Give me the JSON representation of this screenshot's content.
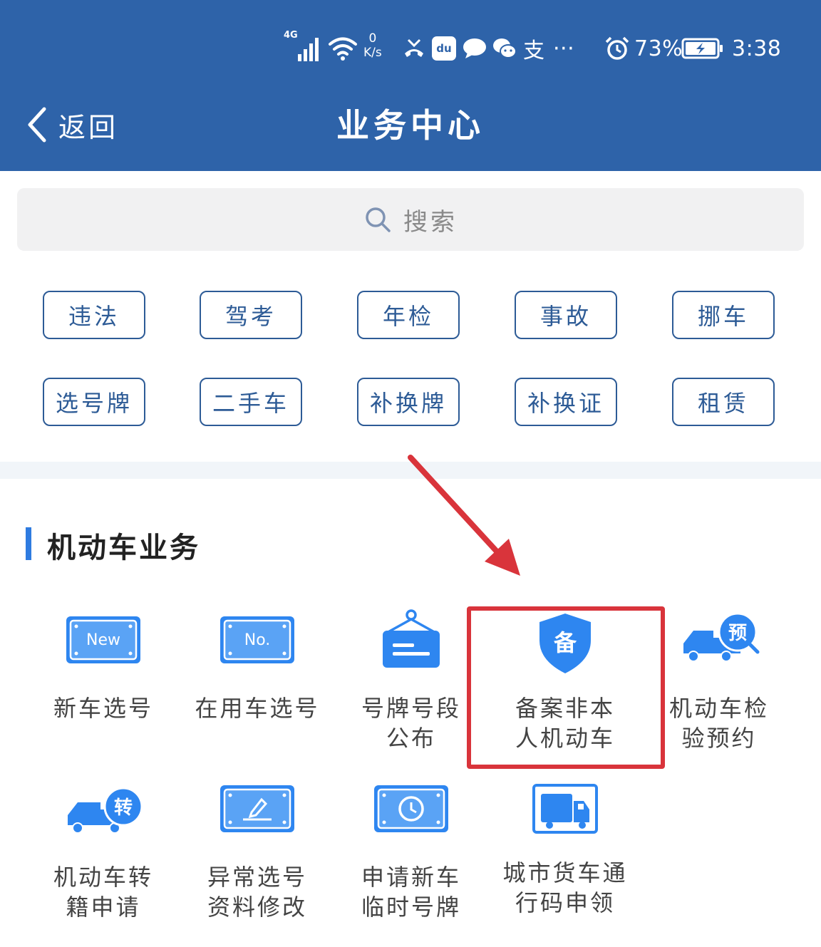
{
  "status_bar": {
    "signal_label": "4G",
    "net_speed_value": "0",
    "net_speed_unit": "K/s",
    "baidu_app_label": "du",
    "alipay_label": "支",
    "more_label": "···",
    "battery_percent": "73%",
    "time": "3:38"
  },
  "nav": {
    "back_label": "返回",
    "title": "业务中心"
  },
  "search": {
    "placeholder": "搜索"
  },
  "quick_tags": [
    "违法",
    "驾考",
    "年检",
    "事故",
    "挪车",
    "选号牌",
    "二手车",
    "补换牌",
    "补换证",
    "租赁"
  ],
  "section": {
    "title": "机动车业务",
    "items": [
      {
        "label": "新车选号",
        "icon": "new-plate-icon",
        "icon_text": "New"
      },
      {
        "label": "在用车选号",
        "icon": "number-plate-icon",
        "icon_text": "No."
      },
      {
        "label": "号牌号段\n公布",
        "icon": "hanging-sign-icon"
      },
      {
        "label": "备案非本\n人机动车",
        "icon": "shield-record-icon",
        "icon_text": "备"
      },
      {
        "label": "机动车检\n验预约",
        "icon": "truck-appointment-icon",
        "icon_text": "预"
      },
      {
        "label": "机动车转\n籍申请",
        "icon": "truck-transfer-icon",
        "icon_text": "转"
      },
      {
        "label": "异常选号\n资料修改",
        "icon": "edit-plate-icon"
      },
      {
        "label": "申请新车\n临时号牌",
        "icon": "clock-plate-icon"
      },
      {
        "label": "城市货车通\n行码申领",
        "icon": "truck-pass-icon"
      }
    ]
  },
  "colors": {
    "header_bg": "#2e63a9",
    "tag_border": "#2d5b96",
    "icon_blue": "#2e86f0",
    "highlight": "#d9343b"
  }
}
